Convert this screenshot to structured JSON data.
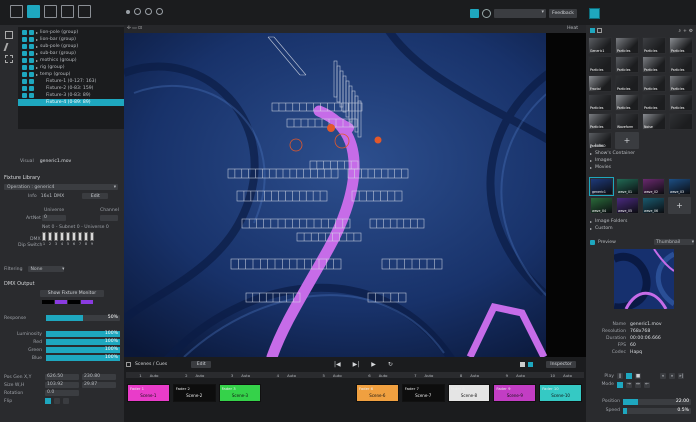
{
  "toolbar": {
    "left_icons": [
      "fixture-icon",
      "cursor-icon",
      "screen-icon",
      "group-icon",
      "gear-icon"
    ],
    "dot_icons": [
      "dot-icon",
      "circle-one-icon",
      "half-circle-icon",
      "refresh-icon"
    ],
    "right_icons": [
      "layout-icon",
      "eye-icon"
    ],
    "dropdown_value": "",
    "button_label": "Feedback"
  },
  "tree": {
    "items": [
      {
        "label": "lion-pole (group)",
        "indent": 0
      },
      {
        "label": "lion-bar (group)",
        "indent": 0
      },
      {
        "label": "sub-pole (group)",
        "indent": 0
      },
      {
        "label": "sub-bar (group)",
        "indent": 0
      },
      {
        "label": "mothics (group)",
        "indent": 0
      },
      {
        "label": "rig (group)",
        "indent": 0
      },
      {
        "label": "temp (group)",
        "indent": 0
      },
      {
        "label": "Fixture-1 (0-127: 163)",
        "indent": 1
      },
      {
        "label": "Fixture-2 (0-83: 159)",
        "indent": 1
      },
      {
        "label": "Fixture-3 (0-83: 89)",
        "indent": 1
      },
      {
        "label": "Fixture-4 (0-89: 89)",
        "indent": 1
      }
    ],
    "selected_index": 10
  },
  "visual": {
    "label": "Visual",
    "value": "generic1.mov"
  },
  "fixture_library": {
    "title": "Fixture Library",
    "type_value": "Operation : generic4",
    "info_label": "Info",
    "info_value": "16x1 DMX",
    "edit_label": "Edit"
  },
  "dmx_address": {
    "universe_label": "Universe",
    "channel_label": "Channel",
    "artnet_label": "ArtNet",
    "artnet_value": "0",
    "net_line": "Net 0 - Subnet 0 - Universe 0",
    "dmx_label": "DMX",
    "dip_label": "Dip Switch",
    "dip_numbers": [
      "1",
      "2",
      "3",
      "4",
      "5",
      "6",
      "7",
      "8",
      "9"
    ]
  },
  "filtering": {
    "label": "Filtering",
    "value": "None"
  },
  "dmx_output": {
    "title": "DMX Output",
    "button_label": "Show Fixture Monitor",
    "response_label": "Response",
    "response_value": "50%",
    "response_fraction": 0.5
  },
  "levels": [
    {
      "label": "Luminosity",
      "value": "100%",
      "fraction": 1.0
    },
    {
      "label": "Red",
      "value": "100%",
      "fraction": 1.0
    },
    {
      "label": "Green",
      "value": "100%",
      "fraction": 1.0
    },
    {
      "label": "Blue",
      "value": "100%",
      "fraction": 1.0
    }
  ],
  "transform": {
    "pos_label": "Pos Gen X,Y",
    "pos_x": "626.50",
    "pos_y": "230.80",
    "size_label": "Size W,H",
    "size_w": "103.92",
    "size_h": "29.87",
    "rotation_label": "Rotation",
    "rotation_value": "0.0",
    "flip_label": "Flip"
  },
  "viewport": {
    "top_right_label": "Heat"
  },
  "scenes": {
    "tab_label": "Scenes / Cues",
    "edit_label": "Edit",
    "transport": [
      "prev-icon",
      "next-icon",
      "play-icon",
      "loop-icon"
    ],
    "inspector_label": "Inspector",
    "slot_headers": [
      {
        "num": "1",
        "mode": "Auto"
      },
      {
        "num": "2",
        "mode": "Auto"
      },
      {
        "num": "3",
        "mode": "Auto"
      },
      {
        "num": "4",
        "mode": "Auto"
      },
      {
        "num": "5",
        "mode": "Auto"
      },
      {
        "num": "6",
        "mode": "Auto"
      },
      {
        "num": "7",
        "mode": "Auto"
      },
      {
        "num": "8",
        "mode": "Auto"
      },
      {
        "num": "9",
        "mode": "Auto"
      },
      {
        "num": "10",
        "mode": "Auto"
      }
    ],
    "cues": [
      {
        "title": "Fader 1",
        "name": "Scene-1",
        "color": "#e93cc9"
      },
      {
        "title": "Fader 2",
        "name": "Scene-2",
        "color": "#0d0d0d"
      },
      {
        "title": "Fader 3",
        "name": "Scene-3",
        "color": "#35d24a"
      },
      {
        "title": "Fader 6",
        "name": "Scene-6",
        "color": "#f0a040"
      },
      {
        "title": "Fader 7",
        "name": "Scene-7",
        "color": "#0d0d0d"
      },
      {
        "title": "Fader 8",
        "name": "Scene-8",
        "color": "#e5e5e5"
      },
      {
        "title": "Fader 9",
        "name": "Scene-9",
        "color": "#c23dc4"
      },
      {
        "title": "Fader 10",
        "name": "Scene-10",
        "color": "#35c9c4"
      }
    ]
  },
  "media": {
    "thumbs": [
      "Generic1",
      "Particles",
      "Particles",
      "Particles",
      "Particles",
      "Particles",
      "Particles",
      "Particles",
      "Fractal",
      "Particles",
      "Particles",
      "Particles",
      "Particles",
      "Particles",
      "Particles",
      "Particles",
      "Particles",
      "Waveform",
      "Noise",
      "",
      "Particles"
    ],
    "folders": [
      "Intro",
      "Show's Container",
      "Images",
      "Movies"
    ],
    "movie_thumbs": [
      "generic1",
      "wave_01",
      "wave_02",
      "wave_03",
      "wave_04",
      "wave_05",
      "wave_06"
    ],
    "folders_after": [
      "Image Folders",
      "Custom"
    ]
  },
  "preview": {
    "label": "Preview",
    "mode": "Thumbnail"
  },
  "info": {
    "name_label": "Name",
    "name_value": "generic1.mov",
    "resolution_label": "Resolution",
    "resolution_value": "768x768",
    "duration_label": "Duration",
    "duration_value": "00:00:06.666",
    "fps_label": "FPS",
    "fps_value": "60",
    "codec_label": "Codec",
    "codec_value": "Hapq"
  },
  "playback": {
    "play_label": "Play",
    "mode_label": "Mode",
    "position_label": "Position",
    "position_value": "22.00",
    "position_fraction": 0.22,
    "speed_label": "Speed",
    "speed_value": "0.5%",
    "speed_fraction": 0.06
  }
}
